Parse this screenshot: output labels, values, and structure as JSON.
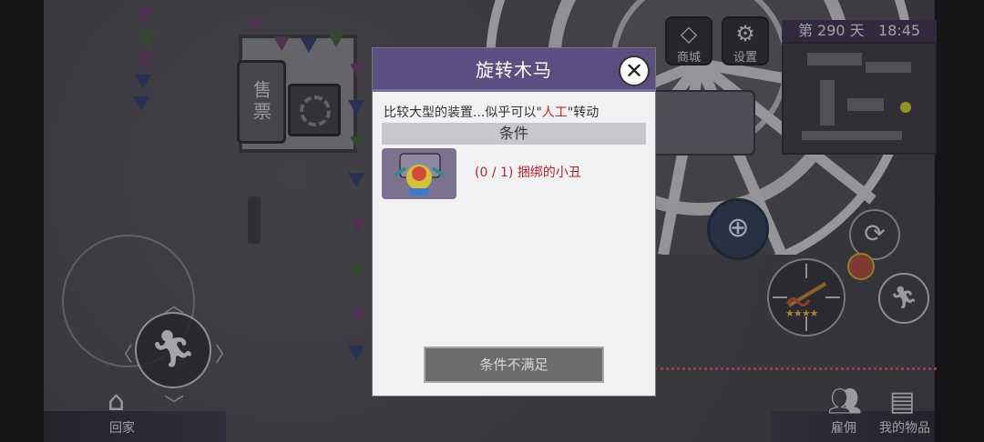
{
  "booth": {
    "sign": "售票"
  },
  "hud": {
    "shop_label": "商城",
    "settings_label": "设置",
    "day_text": "第 290 天",
    "time": "18:45"
  },
  "bottom": {
    "home_label": "回家",
    "hire_label": "雇佣",
    "items_label": "我的物品"
  },
  "icons": {
    "shop": "diamond-icon",
    "settings": "gear-icon",
    "zoom": "magnifier-plus-icon",
    "refresh": "refresh-icon",
    "run": "running-man-icon",
    "home": "house-icon",
    "hire": "people-icon",
    "items": "chest-icon",
    "close": "close-icon"
  },
  "weapon": {
    "stars": 4
  },
  "dialog": {
    "title": "旋转木马",
    "desc_prefix": "比较大型的装置...似乎可以\"",
    "desc_highlight": "人工",
    "desc_suffix": "\"转动",
    "conditions_header": "条件",
    "requirement": {
      "progress": "(0 / 1)",
      "item_name": "捆绑的小丑"
    },
    "button_label": "条件不满足"
  },
  "colors": {
    "dialog_header": "#5b4f82",
    "requirement_text": "#b3262a",
    "day_panel": "#3d3150"
  }
}
